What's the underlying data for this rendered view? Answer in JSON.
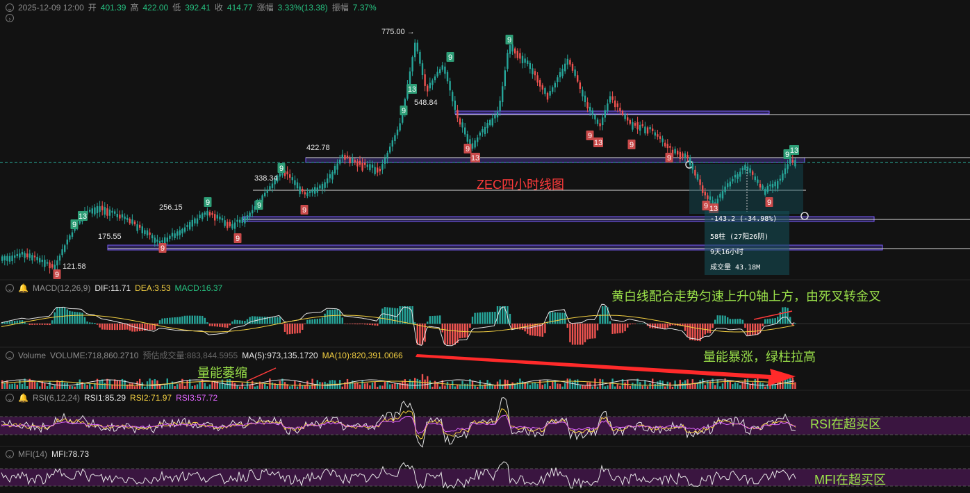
{
  "header": {
    "datetime": "2025-12-09 12:00",
    "open_label": "开",
    "open": "401.39",
    "high_label": "高",
    "high": "422.00",
    "low_label": "低",
    "low": "392.41",
    "close_label": "收",
    "close": "414.77",
    "change_label": "涨幅",
    "change": "3.33%(13.38)",
    "amp_label": "振幅",
    "amp": "7.37%"
  },
  "price_labels": {
    "p775": "775.00 →",
    "p548": "548.84",
    "p422": "422.78",
    "p338": "338.34",
    "p256": "256.15",
    "p175": "175.55",
    "p121": "121.58"
  },
  "chart_title": "ZEC四小时线图",
  "measure": {
    "line1": "-143.2 (-34.98%)",
    "line2": "58柱 (27阳26阴)",
    "line3": "9天16小时",
    "line4": "成交量 43.18M"
  },
  "macd": {
    "title": "MACD(12,26,9)",
    "dif_label": "DIF:11.71",
    "dea_label": "DEA:3.53",
    "macd_label": "MACD:16.37",
    "note": "黄白线配合走势匀速上升0轴上方，由死叉转金叉"
  },
  "volume": {
    "title": "Volume",
    "vol_label": "VOLUME:718,860.2710",
    "est_label": "预估成交量:883,844.5955",
    "ma5_label": "MA(5):973,135.1720",
    "ma10_label": "MA(10):820,391.0066",
    "note_left": "量能萎缩",
    "note_right": "量能暴涨，绿柱拉高"
  },
  "rsi": {
    "title": "RSI(6,12,24)",
    "r1": "RSI1:85.29",
    "r2": "RSI2:71.97",
    "r3": "RSI3:57.72",
    "note": "RSI在超买区"
  },
  "mfi": {
    "title": "MFI(14)",
    "val": "MFI:78.73",
    "note": "MFI在超买区"
  },
  "td_marks": [
    {
      "t": "9",
      "c": "red"
    },
    {
      "t": "13",
      "c": "green"
    },
    {
      "t": "9",
      "c": "green"
    },
    {
      "t": "9",
      "c": "red"
    },
    {
      "t": "9",
      "c": "green"
    },
    {
      "t": "9",
      "c": "red"
    },
    {
      "t": "9",
      "c": "green"
    },
    {
      "t": "9",
      "c": "red"
    },
    {
      "t": "9",
      "c": "green"
    },
    {
      "t": "9",
      "c": "green"
    },
    {
      "t": "13",
      "c": "green"
    },
    {
      "t": "9",
      "c": "green"
    },
    {
      "t": "9",
      "c": "red"
    },
    {
      "t": "13",
      "c": "red"
    },
    {
      "t": "9",
      "c": "green"
    },
    {
      "t": "9",
      "c": "red"
    },
    {
      "t": "13",
      "c": "red"
    },
    {
      "t": "9",
      "c": "red"
    },
    {
      "t": "9",
      "c": "red"
    },
    {
      "t": "9",
      "c": "red"
    },
    {
      "t": "13",
      "c": "red"
    },
    {
      "t": "9",
      "c": "red"
    },
    {
      "t": "9",
      "c": "green"
    },
    {
      "t": "13",
      "c": "green"
    }
  ],
  "colors": {
    "up": "#26a69a",
    "down": "#ef5350",
    "dif": "#e6e6e6",
    "dea": "#f5d142",
    "band": "#7b5cff",
    "overbought": "#3a1540"
  },
  "chart_data": {
    "type": "candlestick",
    "title": "ZEC四小时线图",
    "levels": [
      775.0,
      548.84,
      422.78,
      338.34,
      256.15,
      175.55,
      121.58
    ],
    "last": {
      "open": 401.39,
      "high": 422.0,
      "low": 392.41,
      "close": 414.77
    },
    "indicators": [
      "MACD(12,26,9)",
      "Volume",
      "RSI(6,12,24)",
      "MFI(14)"
    ]
  }
}
